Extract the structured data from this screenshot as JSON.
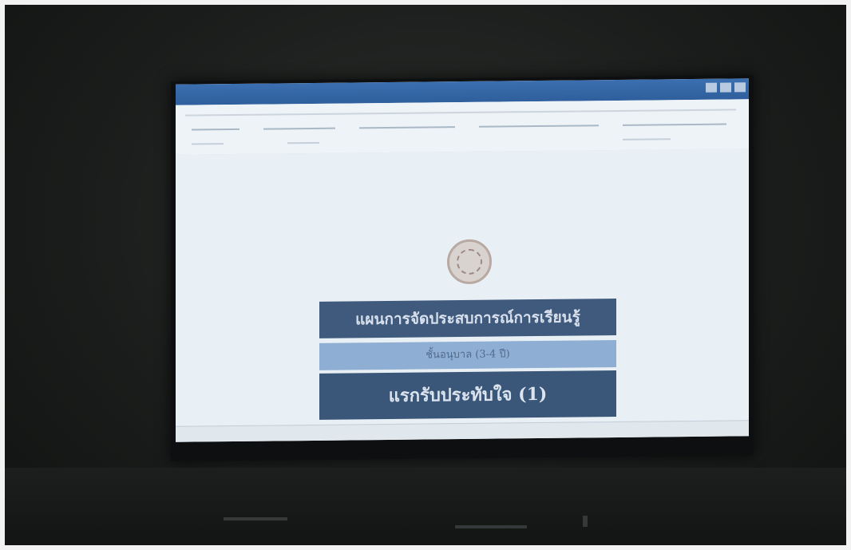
{
  "slide": {
    "plan_title": "แผนการจัดประสบการณ์การเรียนรู้",
    "age_range": "ชั้นอนุบาล (3-4 ปี)",
    "unit_title": "แรกรับประทับใจ (1)"
  },
  "colors": {
    "title_box": "#405a7e",
    "subtitle_box": "#8eaed3",
    "unit_box": "#3a5678",
    "window_titlebar": "#2f5f9c",
    "screen_background": "#e9f0f5"
  },
  "icons": {
    "seal": "school-seal-icon",
    "taskbar": [
      "start-icon",
      "search-icon",
      "folder-icon",
      "browser-icon",
      "word-icon",
      "media-icon",
      "app-icon",
      "app-icon",
      "app-icon"
    ]
  }
}
